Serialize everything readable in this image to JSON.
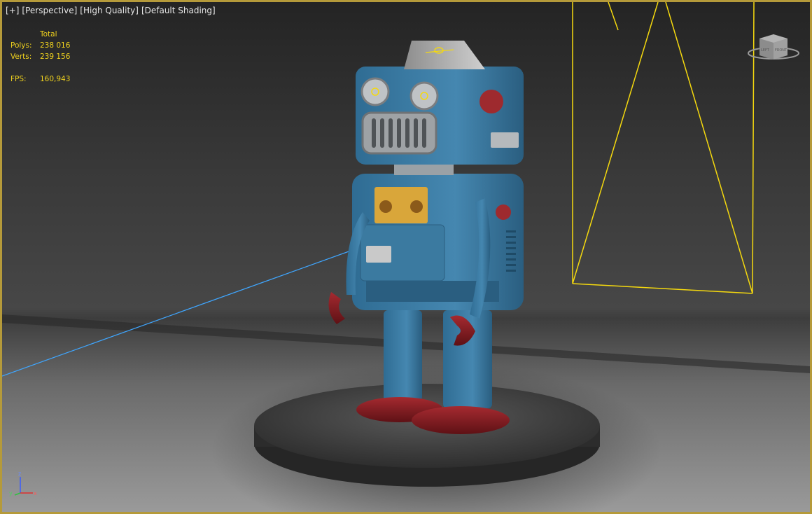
{
  "viewport": {
    "menu": {
      "plus": "[+]",
      "view": "[Perspective]",
      "quality": "[High Quality]",
      "shading": "[Default Shading]"
    },
    "stats": {
      "header": "Total",
      "polys_label": "Polys:",
      "polys_value": "238 016",
      "verts_label": "Verts:",
      "verts_value": "239 156",
      "fps_label": "FPS:",
      "fps_value": "160,943"
    },
    "axis": {
      "x": "x",
      "y": "y",
      "z": "z"
    },
    "viewcube": {
      "left_face": "LEFT",
      "front_face": "FRONT"
    },
    "colors": {
      "frame": "#b59a3a",
      "stats_text": "#f0d21e",
      "light_gizmo": "#f5d90e",
      "target_line": "#3fa6ff",
      "robot_blue": "#3f7fa6",
      "robot_red": "#8a1c22"
    }
  }
}
